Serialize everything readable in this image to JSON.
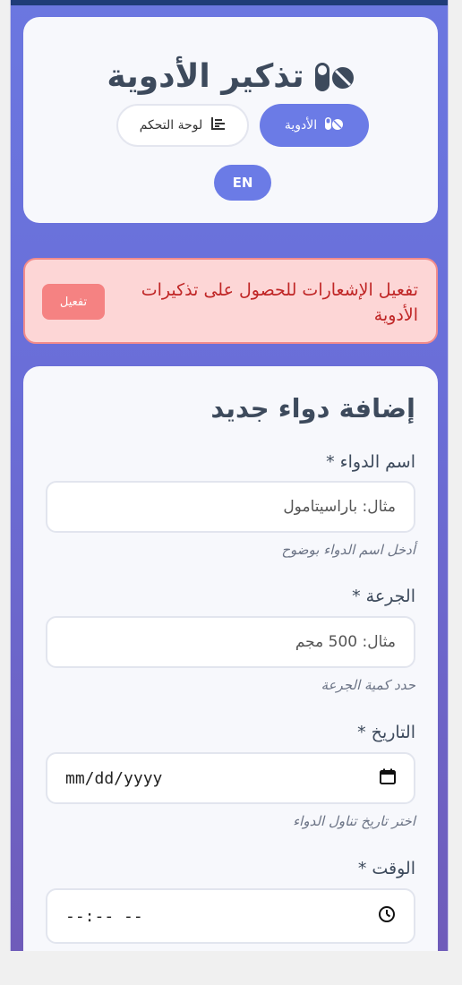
{
  "app": {
    "title": "تذكير الأدوية",
    "nav": {
      "medications": "الأدوية",
      "dashboard": "لوحة التحكم"
    },
    "lang_toggle": "EN"
  },
  "notification": {
    "message": "تفعيل الإشعارات للحصول على تذكيرات الأدوية",
    "enable_label": "تفعيل"
  },
  "form": {
    "title": "إضافة دواء جديد",
    "fields": [
      {
        "label": "اسم الدواء *",
        "placeholder": "مثال: باراسيتامول",
        "hint": "أدخل اسم الدواء بوضوح"
      },
      {
        "label": "الجرعة *",
        "placeholder": "مثال: 500 مجم",
        "hint": "حدد كمية الجرعة"
      },
      {
        "label": "التاريخ *",
        "placeholder": "mm/dd/yyyy",
        "hint": "اختر تاريخ تناول الدواء"
      },
      {
        "label": "الوقت *",
        "placeholder": "--:-- --",
        "hint": ""
      }
    ]
  },
  "colors": {
    "accent": "#6b7be6",
    "title": "#3d4a5c",
    "alert_bg": "#fdd6d6",
    "alert_text": "#c02626"
  },
  "icons": {
    "title_icon": "pills-icon",
    "nav_medications_icon": "pills-icon",
    "nav_dashboard_icon": "chart-icon",
    "date_icon": "calendar-icon",
    "time_icon": "clock-icon"
  }
}
